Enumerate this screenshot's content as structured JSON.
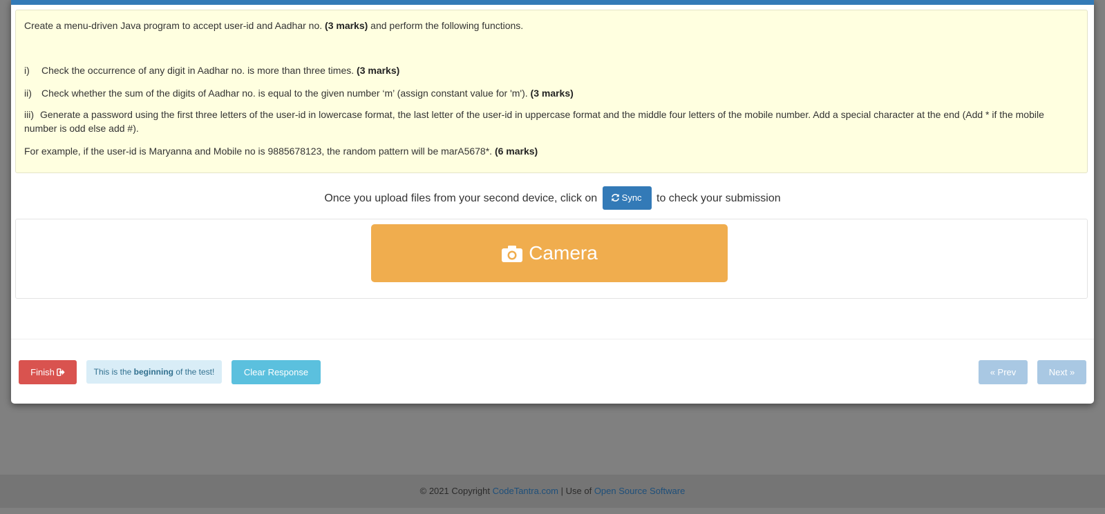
{
  "question": {
    "intro_pre": "Create a menu-driven Java program to accept user-id and Aadhar no. ",
    "intro_marks": "(3 marks)",
    "intro_post": " and perform the following functions.",
    "items": [
      {
        "num": "i)",
        "text": "Check the occurrence of any digit in Aadhar no. is more than three times. ",
        "marks": "(3 marks)"
      },
      {
        "num": "ii)",
        "text": "Check whether the sum of the digits of Aadhar no. is equal to the given number ‘m’ (assign constant value for 'm'). ",
        "marks": "(3 marks)"
      },
      {
        "num": "iii)",
        "text": "Generate a password using the first three letters of the user-id in lowercase format, the last letter of the user-id in uppercase format and the middle four letters of the mobile number. Add a special character at the end (Add * if the mobile number is odd else add #)."
      }
    ],
    "example_text": "For example, if the user-id is Maryanna and Mobile no is 9885678123, the random pattern will be marA5678*. ",
    "example_marks": "(6 marks)"
  },
  "sync": {
    "pre_text": "Once you upload files from your second device, click on",
    "button_label": "Sync",
    "post_text": "to check your submission"
  },
  "camera": {
    "label": "Camera"
  },
  "footer_buttons": {
    "finish_label": "Finish",
    "begin_pre": "This is the ",
    "begin_bold": "beginning",
    "begin_post": " of the test!",
    "clear_label": "Clear Response",
    "prev_label": "« Prev",
    "next_label": "Next »"
  },
  "footer": {
    "copyright": "© 2021 Copyright ",
    "brand_link": "CodeTantra.com",
    "separator": " | Use of ",
    "oss_link": "Open Source Software"
  },
  "colors": {
    "topbar": "#337ab7",
    "question_bg": "#ffffe0",
    "sync": "#337ab7",
    "camera": "#f0ad4e",
    "finish": "#d9534f",
    "clear": "#5bc0de",
    "nav_disabled": "#a9c8e3"
  }
}
